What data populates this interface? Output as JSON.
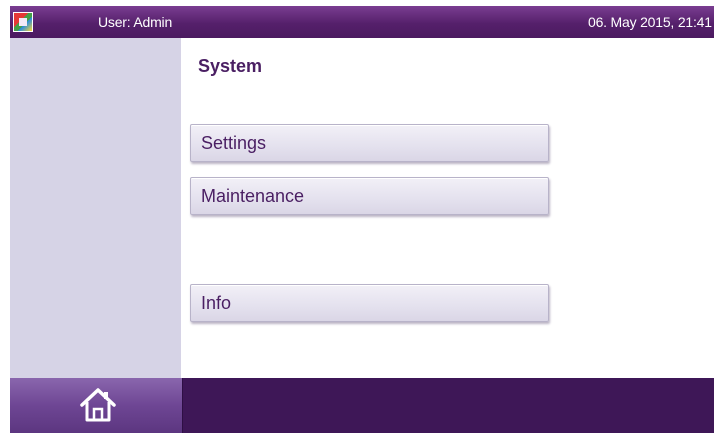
{
  "header": {
    "user_label": "User: Admin",
    "datetime": "06. May 2015, 21:41"
  },
  "page": {
    "title": "System"
  },
  "menu": {
    "settings_label": "Settings",
    "maintenance_label": "Maintenance",
    "info_label": "Info"
  },
  "footer": {
    "home_icon": "home-icon"
  },
  "colors": {
    "accent": "#55206b",
    "sidebar": "#d6d3e6",
    "bottom_bar": "#3e1757",
    "button_text": "#4a1f63"
  }
}
